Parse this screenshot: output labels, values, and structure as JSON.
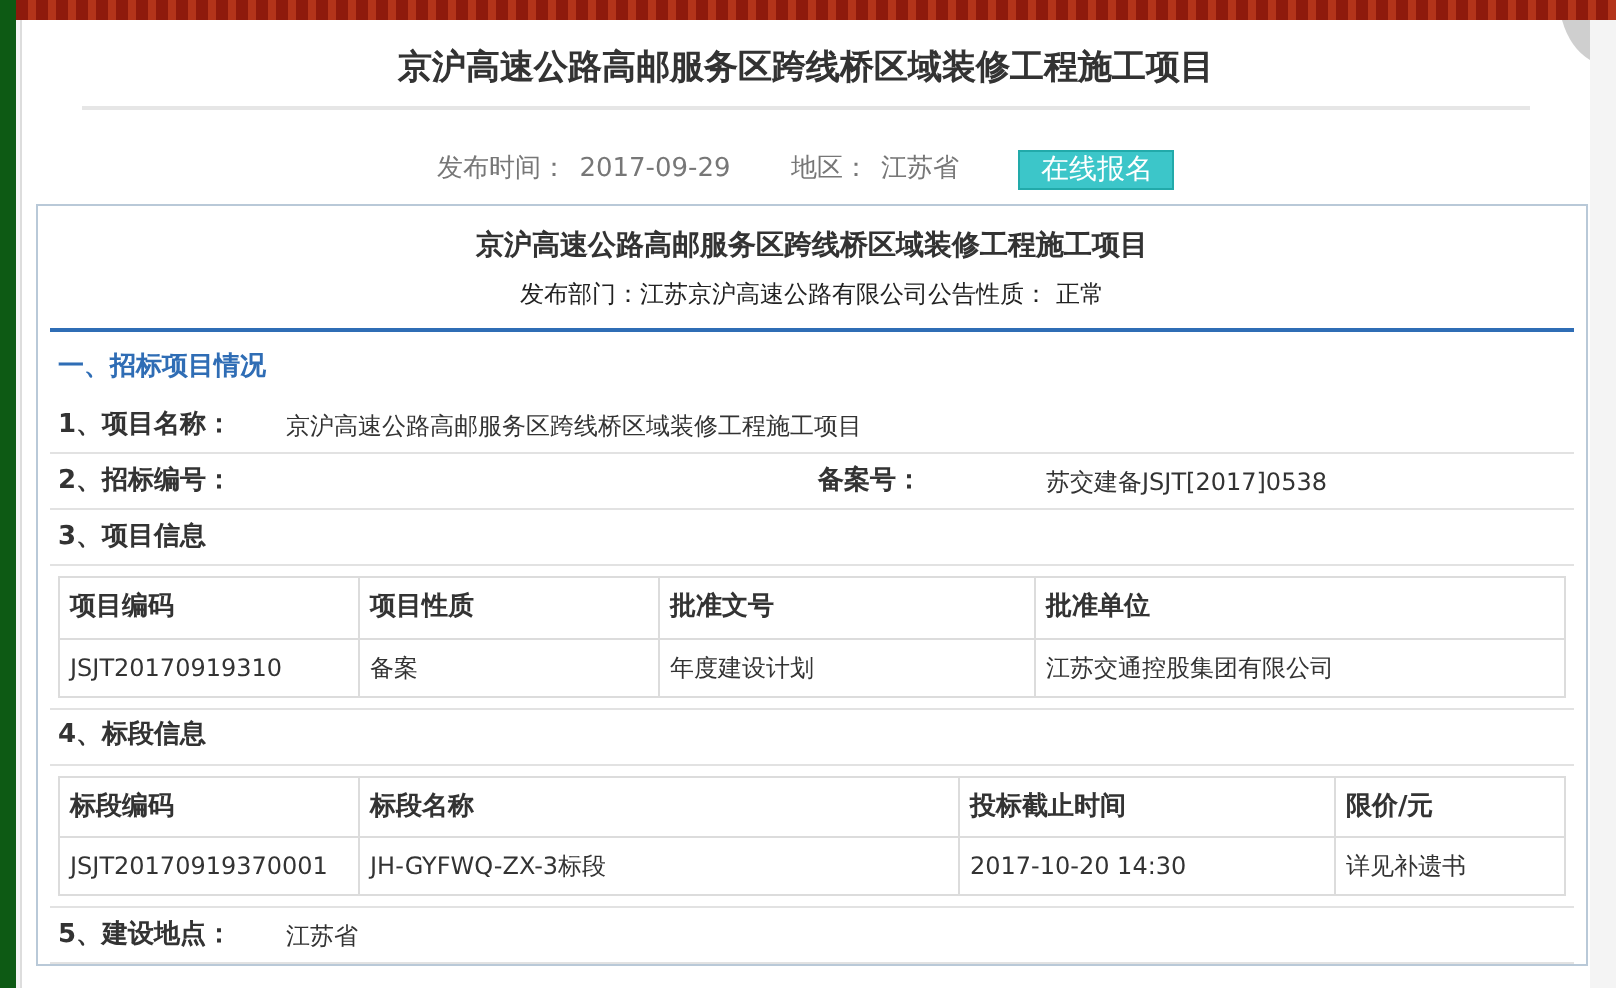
{
  "title": "京沪高速公路高邮服务区跨线桥区域装修工程施工项目",
  "meta": {
    "date_label": "发布时间：",
    "date": "2017-09-29",
    "region_label": "地区：",
    "region": "江苏省",
    "register_button": "在线报名"
  },
  "notice": {
    "title": "京沪高速公路高邮服务区跨线桥区域装修工程施工项目",
    "department_label": "发布部门：",
    "department": "江苏京沪高速公路有限公司",
    "nature_label": "公告性质：",
    "nature": "正常"
  },
  "section": "一、招标项目情况",
  "items": [
    {
      "kind": "field",
      "label": "1、项目名称：",
      "value": "京沪高速公路高邮服务区跨线桥区域装修工程施工项目"
    },
    {
      "kind": "pair",
      "label": "2、招标编号：",
      "extra_label": "备案号：",
      "extra_value": "苏交建备JSJT[2017]0538"
    },
    {
      "kind": "table",
      "label": "3、项目信息",
      "columns": [
        "项目编码",
        "项目性质",
        "批准文号",
        "批准单位"
      ],
      "rows": [
        [
          "JSJT20170919310",
          "备案",
          "年度建设计划",
          "江苏交通控股集团有限公司"
        ]
      ]
    },
    {
      "kind": "table",
      "label": "4、标段信息",
      "columns": [
        "标段编码",
        "标段名称",
        "投标截止时间",
        "限价/元"
      ],
      "rows": [
        [
          "JSJT20170919370001",
          "JH-GYFWQ-ZX-3标段",
          "2017-10-20 14:30",
          "详见补遗书"
        ]
      ]
    },
    {
      "kind": "field",
      "label": "5、建设地点：",
      "value": "江苏省"
    }
  ]
}
